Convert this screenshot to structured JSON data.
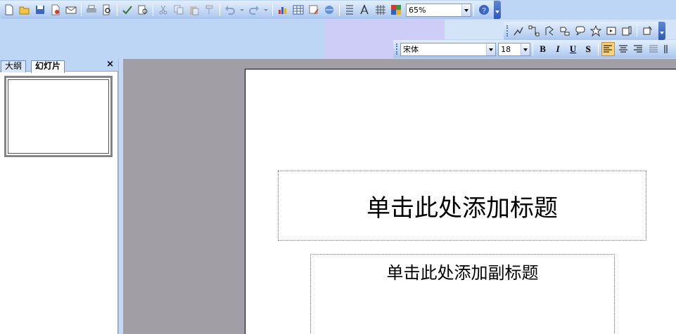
{
  "standard_toolbar": {
    "buttons": [
      "new-icon",
      "open-icon",
      "save-icon",
      "permission-icon",
      "email-icon",
      "print-icon",
      "print-preview-icon",
      "spelling-icon",
      "research-icon",
      "cut-icon",
      "copy-icon",
      "paste-icon",
      "format-painter-icon",
      "undo-icon",
      "redo-icon",
      "insert-chart-icon",
      "insert-table-icon",
      "tables-borders-icon",
      "insert-hyperlink-icon",
      "expand-all-icon",
      "show-formatting-icon",
      "show-grid-icon",
      "color-grayscale-icon",
      "help-icon"
    ],
    "zoom_value": "65%"
  },
  "drawing_toolbar": {
    "buttons": [
      "autoshapes-icon",
      "connector-icon",
      "freeform-icon",
      "flowchart-icon",
      "callout-icon",
      "star-banner-icon",
      "action-button-icon",
      "more-autoshapes-icon",
      "rotate-icon"
    ]
  },
  "formatting_toolbar": {
    "font_name": "宋体",
    "font_size": "18",
    "bold": "B",
    "italic": "I",
    "underline": "U",
    "shadow": "S"
  },
  "left_pane": {
    "tab_outline": "大纲",
    "tab_slides": "幻灯片",
    "close": "×"
  },
  "slide": {
    "title_placeholder": "单击此处添加标题",
    "subtitle_placeholder": "单击此处添加副标题"
  },
  "colors": {
    "toolbar_band": "#bed6f6",
    "workspace": "#a19ea6",
    "active_button": "#fbd27c"
  }
}
